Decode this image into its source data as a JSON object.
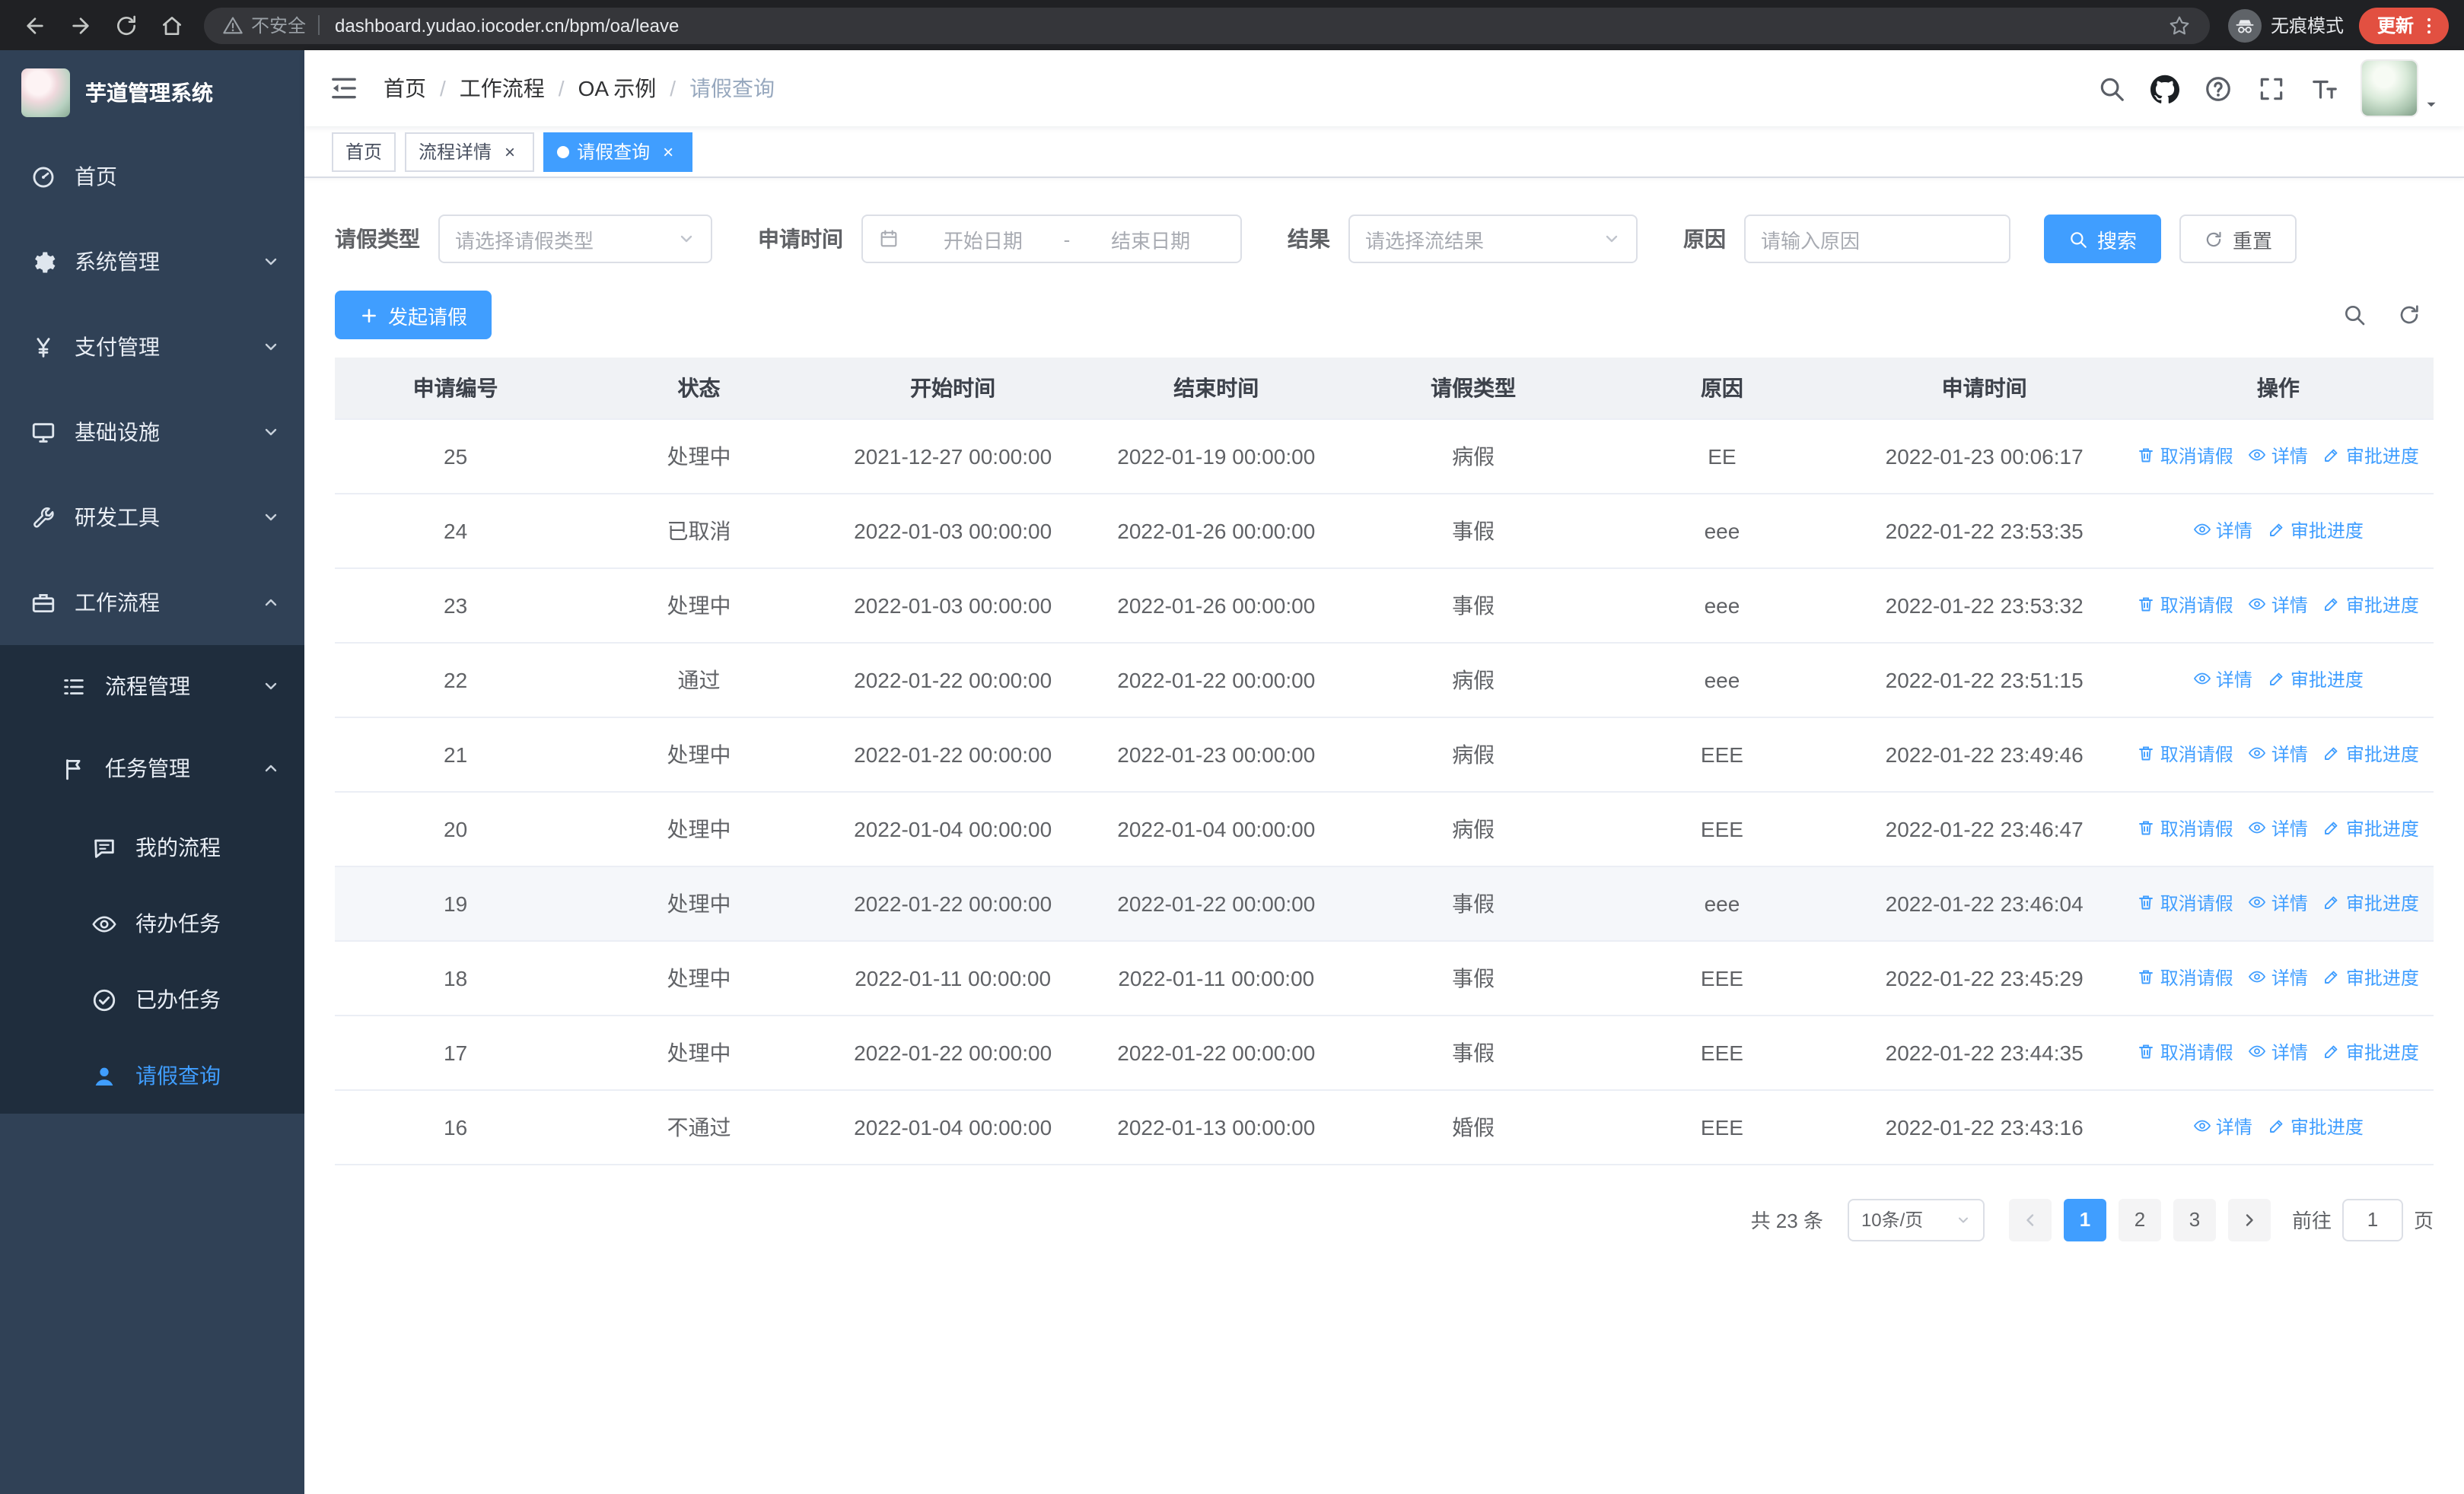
{
  "colors": {
    "primary": "#409eff",
    "sidebar-bg": "#304156",
    "submenu-bg": "#1f2d3d",
    "chrome-bg": "#202124",
    "chrome-pill": "#35363a",
    "update-red": "#e25041",
    "table-header-bg": "#f0f2f5"
  },
  "browser": {
    "nav_icons": [
      "back-icon",
      "forward-icon",
      "reload-icon",
      "home-icon"
    ],
    "security_label": "不安全",
    "url": "dashboard.yudao.iocoder.cn/bpm/oa/leave",
    "incognito_label": "无痕模式",
    "update_label": "更新"
  },
  "sidebar": {
    "logo_title": "芋道管理系统",
    "items": [
      {
        "id": "home",
        "label": "首页",
        "icon": "dashboard-icon",
        "level": 1
      },
      {
        "id": "system",
        "label": "系统管理",
        "icon": "gear-icon",
        "level": 1,
        "arrow": "down"
      },
      {
        "id": "payment",
        "label": "支付管理",
        "icon": "yen-icon",
        "level": 1,
        "arrow": "down"
      },
      {
        "id": "infra",
        "label": "基础设施",
        "icon": "server-icon",
        "level": 1,
        "arrow": "down"
      },
      {
        "id": "devtools",
        "label": "研发工具",
        "icon": "tools-icon",
        "level": 1,
        "arrow": "down"
      },
      {
        "id": "workflow",
        "label": "工作流程",
        "icon": "briefcase-icon",
        "level": 1,
        "arrow": "up"
      },
      {
        "id": "process-manage",
        "label": "流程管理",
        "icon": "list-icon",
        "level": 2,
        "arrow": "down"
      },
      {
        "id": "task-manage",
        "label": "任务管理",
        "icon": "flag-icon",
        "level": 2,
        "arrow": "up"
      },
      {
        "id": "my-process",
        "label": "我的流程",
        "icon": "chat-icon",
        "level": 3
      },
      {
        "id": "todo-tasks",
        "label": "待办任务",
        "icon": "eye-icon",
        "level": 3
      },
      {
        "id": "done-tasks",
        "label": "已办任务",
        "icon": "check-circle-icon",
        "level": 3
      },
      {
        "id": "leave-query",
        "label": "请假查询",
        "icon": "user-icon",
        "level": 3,
        "active": true
      }
    ]
  },
  "header": {
    "breadcrumb": [
      "首页",
      "工作流程",
      "OA 示例",
      "请假查询"
    ],
    "icons": [
      "search-icon",
      "github-icon",
      "question-icon",
      "fullscreen-icon",
      "font-size-icon"
    ]
  },
  "tabs": [
    {
      "id": "home",
      "label": "首页",
      "closable": false,
      "active": false
    },
    {
      "id": "process-detail",
      "label": "流程详情",
      "closable": true,
      "active": false
    },
    {
      "id": "leave-query",
      "label": "请假查询",
      "closable": true,
      "active": true
    }
  ],
  "filters": {
    "leave_type_label": "请假类型",
    "leave_type_placeholder": "请选择请假类型",
    "apply_time_label": "申请时间",
    "date_start_placeholder": "开始日期",
    "date_separator": "-",
    "date_end_placeholder": "结束日期",
    "result_label": "结果",
    "result_placeholder": "请选择流结果",
    "reason_label": "原因",
    "reason_placeholder": "请输入原因",
    "search_button": "搜索",
    "reset_button": "重置"
  },
  "toolbar": {
    "create_button": "发起请假",
    "right_icons": [
      "search-icon",
      "refresh-icon"
    ]
  },
  "table": {
    "columns": [
      "申请编号",
      "状态",
      "开始时间",
      "结束时间",
      "请假类型",
      "原因",
      "申请时间",
      "操作"
    ],
    "action_labels": {
      "cancel": "取消请假",
      "detail": "详情",
      "progress": "审批进度"
    },
    "rows": [
      {
        "no": "25",
        "status": "处理中",
        "start": "2021-12-27 00:00:00",
        "end": "2022-01-19 00:00:00",
        "type": "病假",
        "reason": "EE",
        "apply": "2022-01-23 00:06:17",
        "actions": [
          "cancel",
          "detail",
          "progress"
        ]
      },
      {
        "no": "24",
        "status": "已取消",
        "start": "2022-01-03 00:00:00",
        "end": "2022-01-26 00:00:00",
        "type": "事假",
        "reason": "eee",
        "apply": "2022-01-22 23:53:35",
        "actions": [
          "detail",
          "progress"
        ]
      },
      {
        "no": "23",
        "status": "处理中",
        "start": "2022-01-03 00:00:00",
        "end": "2022-01-26 00:00:00",
        "type": "事假",
        "reason": "eee",
        "apply": "2022-01-22 23:53:32",
        "actions": [
          "cancel",
          "detail",
          "progress"
        ]
      },
      {
        "no": "22",
        "status": "通过",
        "start": "2022-01-22 00:00:00",
        "end": "2022-01-22 00:00:00",
        "type": "病假",
        "reason": "eee",
        "apply": "2022-01-22 23:51:15",
        "actions": [
          "detail",
          "progress"
        ]
      },
      {
        "no": "21",
        "status": "处理中",
        "start": "2022-01-22 00:00:00",
        "end": "2022-01-23 00:00:00",
        "type": "病假",
        "reason": "EEE",
        "apply": "2022-01-22 23:49:46",
        "actions": [
          "cancel",
          "detail",
          "progress"
        ]
      },
      {
        "no": "20",
        "status": "处理中",
        "start": "2022-01-04 00:00:00",
        "end": "2022-01-04 00:00:00",
        "type": "病假",
        "reason": "EEE",
        "apply": "2022-01-22 23:46:47",
        "actions": [
          "cancel",
          "detail",
          "progress"
        ]
      },
      {
        "no": "19",
        "status": "处理中",
        "start": "2022-01-22 00:00:00",
        "end": "2022-01-22 00:00:00",
        "type": "事假",
        "reason": "eee",
        "apply": "2022-01-22 23:46:04",
        "actions": [
          "cancel",
          "detail",
          "progress"
        ],
        "hover": true
      },
      {
        "no": "18",
        "status": "处理中",
        "start": "2022-01-11 00:00:00",
        "end": "2022-01-11 00:00:00",
        "type": "事假",
        "reason": "EEE",
        "apply": "2022-01-22 23:45:29",
        "actions": [
          "cancel",
          "detail",
          "progress"
        ]
      },
      {
        "no": "17",
        "status": "处理中",
        "start": "2022-01-22 00:00:00",
        "end": "2022-01-22 00:00:00",
        "type": "事假",
        "reason": "EEE",
        "apply": "2022-01-22 23:44:35",
        "actions": [
          "cancel",
          "detail",
          "progress"
        ]
      },
      {
        "no": "16",
        "status": "不通过",
        "start": "2022-01-04 00:00:00",
        "end": "2022-01-13 00:00:00",
        "type": "婚假",
        "reason": "EEE",
        "apply": "2022-01-22 23:43:16",
        "actions": [
          "detail",
          "progress"
        ]
      }
    ]
  },
  "pagination": {
    "total_text": "共 23 条",
    "page_size": "10条/页",
    "pages": [
      "1",
      "2",
      "3"
    ],
    "active_page": "1",
    "goto_prefix": "前往",
    "goto_value": "1",
    "goto_suffix": "页"
  }
}
